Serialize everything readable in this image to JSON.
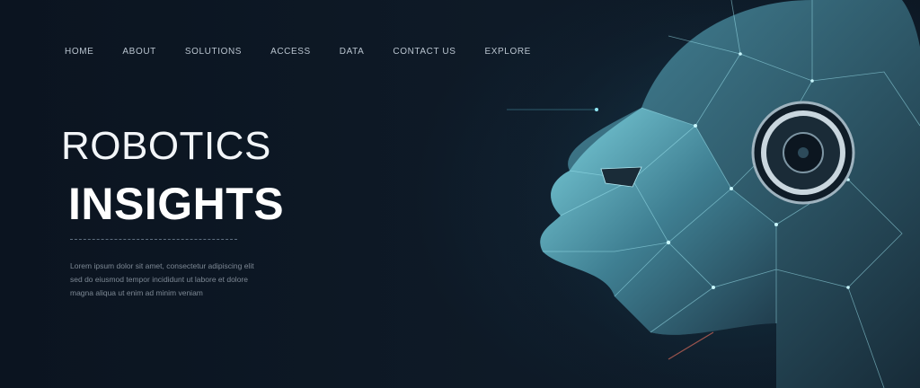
{
  "nav": {
    "items": [
      {
        "label": "HOME"
      },
      {
        "label": "ABOUT"
      },
      {
        "label": "SOLUTIONS"
      },
      {
        "label": "ACCESS"
      },
      {
        "label": "DATA"
      },
      {
        "label": "CONTACT US"
      },
      {
        "label": "EXPLORE"
      }
    ]
  },
  "hero": {
    "title_line1": "ROBOTICS",
    "title_line2": "INSIGHTS",
    "body_lines": [
      "Lorem ipsum dolor sit amet, consectetur adipiscing elit",
      "sed do eiusmod tempor incididunt ut labore et dolore",
      "magna aliqua ut enim ad minim veniam"
    ]
  },
  "colors": {
    "background": "#0c1520",
    "accent": "#5ec8d8",
    "text": "#f2f5f8"
  },
  "illustration": {
    "icon": "robot-head-icon"
  }
}
